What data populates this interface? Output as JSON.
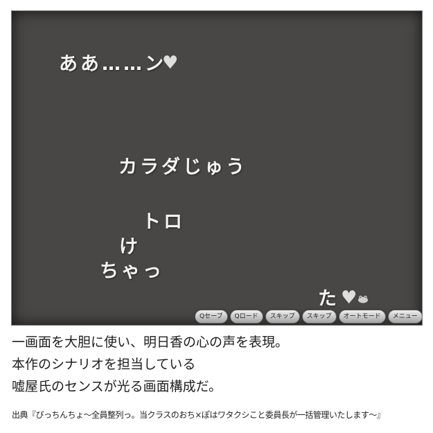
{
  "game_screen": {
    "text_lines": [
      "ああ……ン",
      "カラダじゅう",
      "トロ",
      "け",
      "ちゃっ",
      "た"
    ],
    "menu_buttons": [
      "Qセーブ",
      "Qロード",
      "スキップ",
      "スキップ",
      "オートモード",
      "メニュー",
      "×"
    ]
  },
  "caption": {
    "lines": [
      "一画面を大胆に使い、明日香の心の声を表現。",
      "本作のシナリオを担当している",
      "嘘屋氏のセンスが光る画面構成だ。"
    ],
    "source": "出典『ぴっちんちょ～全員整列っ。当クラスのおち×ぽはワタクシこと委員長が一括管理いたします～』"
  },
  "colors": {
    "screen_bg": "#494745",
    "text": "#f4f4f4",
    "heart": "#dedede"
  }
}
